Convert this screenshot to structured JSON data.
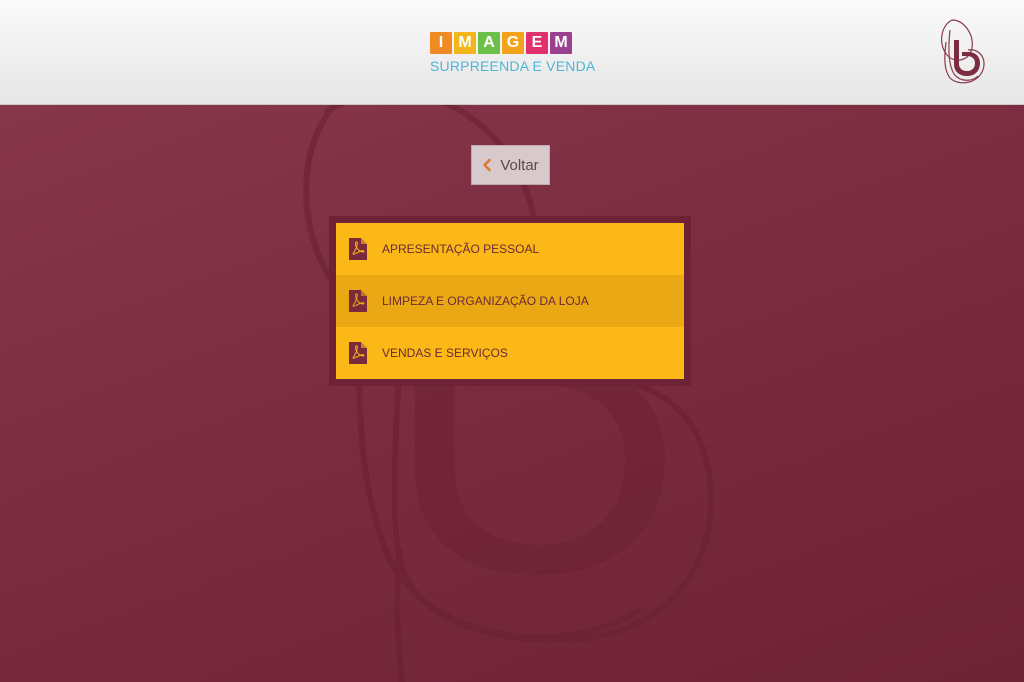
{
  "header": {
    "brand_letters": [
      "I",
      "M",
      "A",
      "G",
      "E",
      "M"
    ],
    "tagline": "SURPREENDA E VENDA"
  },
  "back_button": {
    "label": "Voltar"
  },
  "menu": {
    "items": [
      {
        "label": "APRESENTAÇÃO PESSOAL",
        "icon": "pdf-icon"
      },
      {
        "label": "LIMPEZA E ORGANIZAÇÃO DA LOJA",
        "icon": "pdf-icon"
      },
      {
        "label": "VENDAS E SERVIÇOS",
        "icon": "pdf-icon"
      }
    ]
  },
  "colors": {
    "background": "#7c2c40",
    "menu_item": "#fbb817",
    "menu_item_alt": "#eaa914",
    "tagline": "#4fb5d6",
    "tiles": [
      "#f08a24",
      "#f2b51a",
      "#6cc04a",
      "#f3a31b",
      "#e0316e",
      "#9b3f8f"
    ]
  }
}
